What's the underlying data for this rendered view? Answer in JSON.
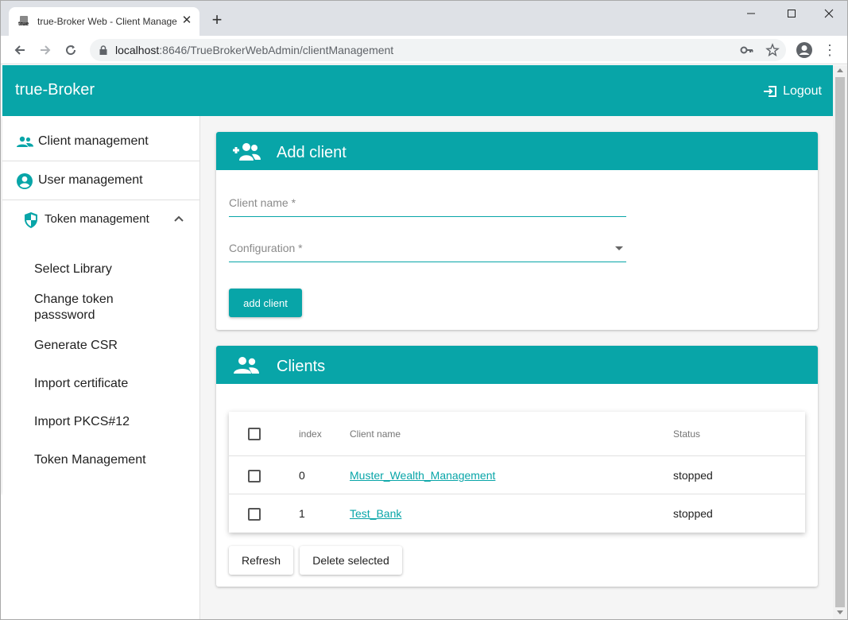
{
  "browser": {
    "tab_title": "true-Broker Web - Client Management",
    "new_tab_label": "+",
    "url_host": "localhost",
    "url_rest": ":8646/TrueBrokerWebAdmin/clientManagement"
  },
  "app": {
    "title": "true-Broker",
    "logout_label": "Logout"
  },
  "sidebar": {
    "items": [
      {
        "label": "Client management",
        "icon": "people-icon"
      },
      {
        "label": "User management",
        "icon": "account-circle-icon"
      }
    ],
    "token_group": {
      "label": "Token management",
      "icon": "shield-icon",
      "expanded": true,
      "subitems": [
        "Select Library",
        "Change token passsword",
        "Generate CSR",
        "Import certificate",
        "Import PKCS#12",
        "Token Management"
      ]
    }
  },
  "add_client": {
    "title": "Add client",
    "client_name_placeholder": "Client name *",
    "configuration_placeholder": "Configuration *",
    "submit_label": "add client"
  },
  "clients": {
    "title": "Clients",
    "columns": [
      "index",
      "Client name",
      "Status"
    ],
    "rows": [
      {
        "index": "0",
        "name": "Muster_Wealth_Management",
        "status": "stopped"
      },
      {
        "index": "1",
        "name": "Test_Bank",
        "status": "stopped"
      }
    ],
    "refresh_label": "Refresh",
    "delete_label": "Delete selected"
  },
  "colors": {
    "primary": "#08a5a8"
  }
}
